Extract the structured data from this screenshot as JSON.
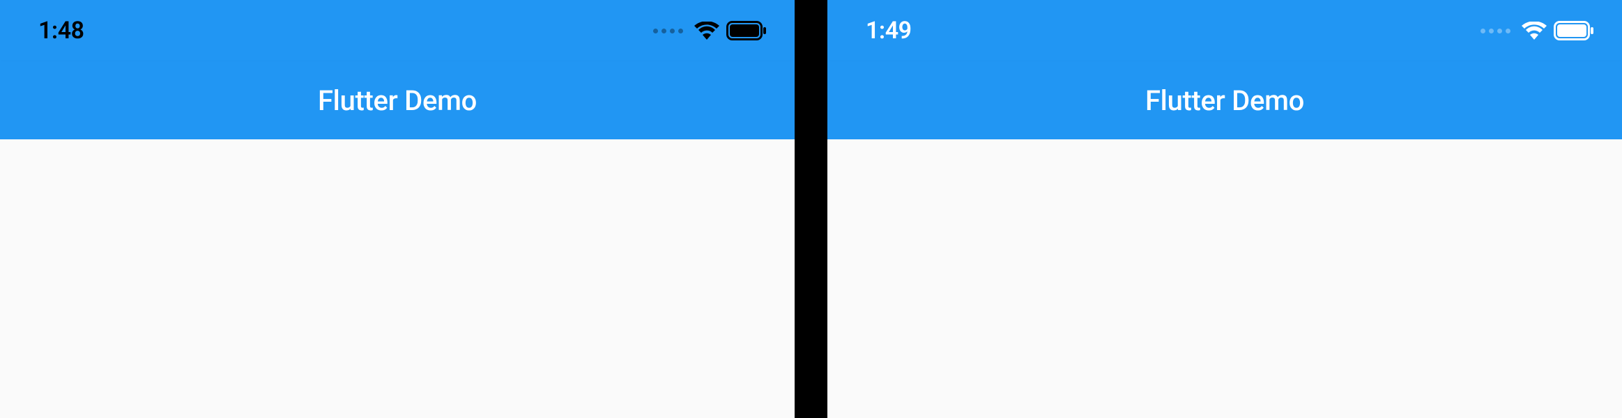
{
  "screens": {
    "left": {
      "status_time": "1:48",
      "status_variant": "dark",
      "app_title": "Flutter Demo"
    },
    "right": {
      "status_time": "1:49",
      "status_variant": "light",
      "app_title": "Flutter Demo"
    }
  },
  "colors": {
    "primary": "#2196F3",
    "background": "#fafafa"
  }
}
